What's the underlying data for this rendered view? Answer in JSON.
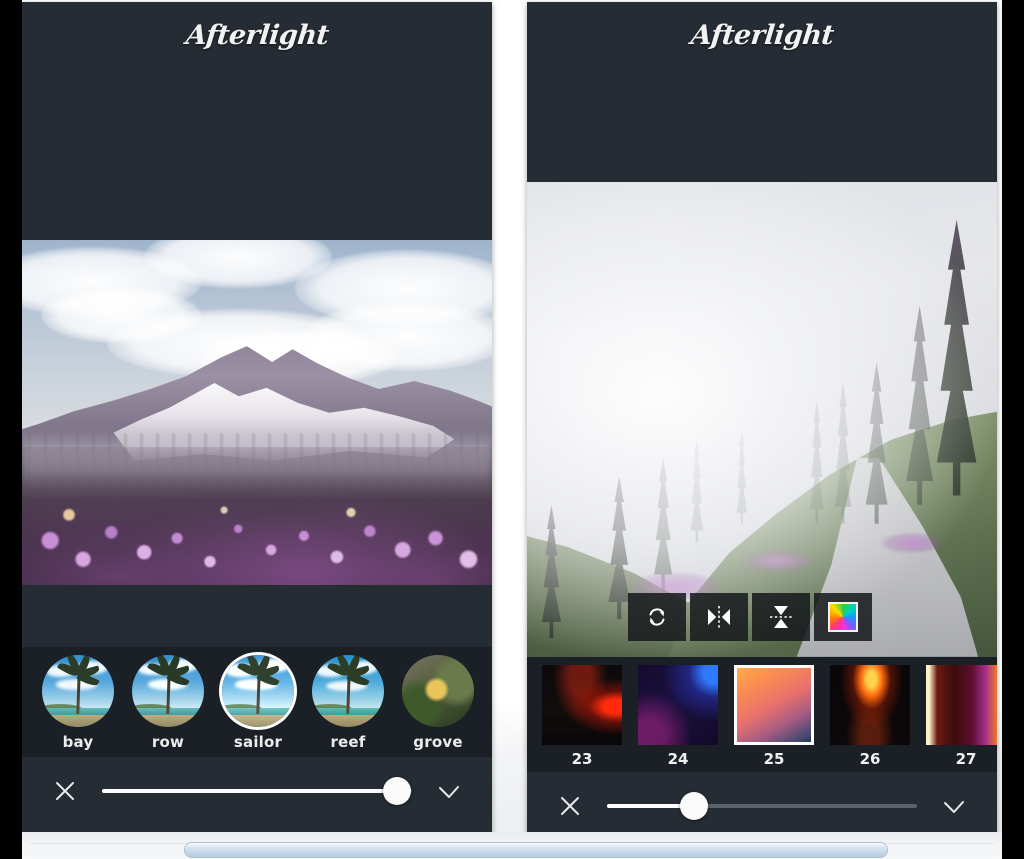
{
  "app": {
    "name": "Afterlight",
    "logo_text": "Afterlight"
  },
  "panels": [
    {
      "id": "left",
      "screen_name": "filters-screen",
      "logo_text": "Afterlight",
      "photo_alt": "Snow-capped mountain with clouds and purple wildflower meadow",
      "filters": [
        {
          "label": "bay",
          "selected": false
        },
        {
          "label": "row",
          "selected": false
        },
        {
          "label": "sailor",
          "selected": true
        },
        {
          "label": "reef",
          "selected": false
        },
        {
          "label": "grove",
          "selected": false
        },
        {
          "label": "",
          "selected": false
        }
      ],
      "slider": {
        "name": "filter-intensity-slider",
        "value": 95,
        "min": 0,
        "max": 100
      },
      "actions": {
        "cancel_icon": "close-icon",
        "confirm_icon": "check-icon"
      }
    },
    {
      "id": "right",
      "screen_name": "light-leaks-screen",
      "logo_text": "Afterlight",
      "photo_alt": "Foggy alpine forest path with pine trees and purple wildflowers",
      "toolbar": [
        {
          "name": "rotate-button",
          "icon": "rotate-icon"
        },
        {
          "name": "flip-horizontal-button",
          "icon": "mirror-horizontal-icon"
        },
        {
          "name": "flip-vertical-button",
          "icon": "mirror-vertical-icon"
        },
        {
          "name": "color-picker-button",
          "icon": "color-wheel-icon"
        }
      ],
      "presets": [
        {
          "label": "23",
          "selected": false
        },
        {
          "label": "24",
          "selected": false
        },
        {
          "label": "25",
          "selected": true
        },
        {
          "label": "26",
          "selected": false
        },
        {
          "label": "27",
          "selected": false
        },
        {
          "label": "",
          "selected": false
        }
      ],
      "slider": {
        "name": "leak-opacity-slider",
        "value": 28,
        "min": 0,
        "max": 100
      },
      "actions": {
        "cancel_icon": "close-icon",
        "confirm_icon": "check-icon"
      }
    }
  ],
  "colors": {
    "chrome_dark": "#262c33",
    "strip_dark": "#1b2026",
    "accent_white": "#ffffff",
    "track_inactive": "#5c6269",
    "page_background": "#ffffff",
    "scrollbar_blue": "#c3d5e8"
  },
  "scrollbar": {
    "name": "horizontal-scrollbar",
    "orientation": "horizontal",
    "thumb_position_percent": 16,
    "thumb_width_percent": 73
  }
}
